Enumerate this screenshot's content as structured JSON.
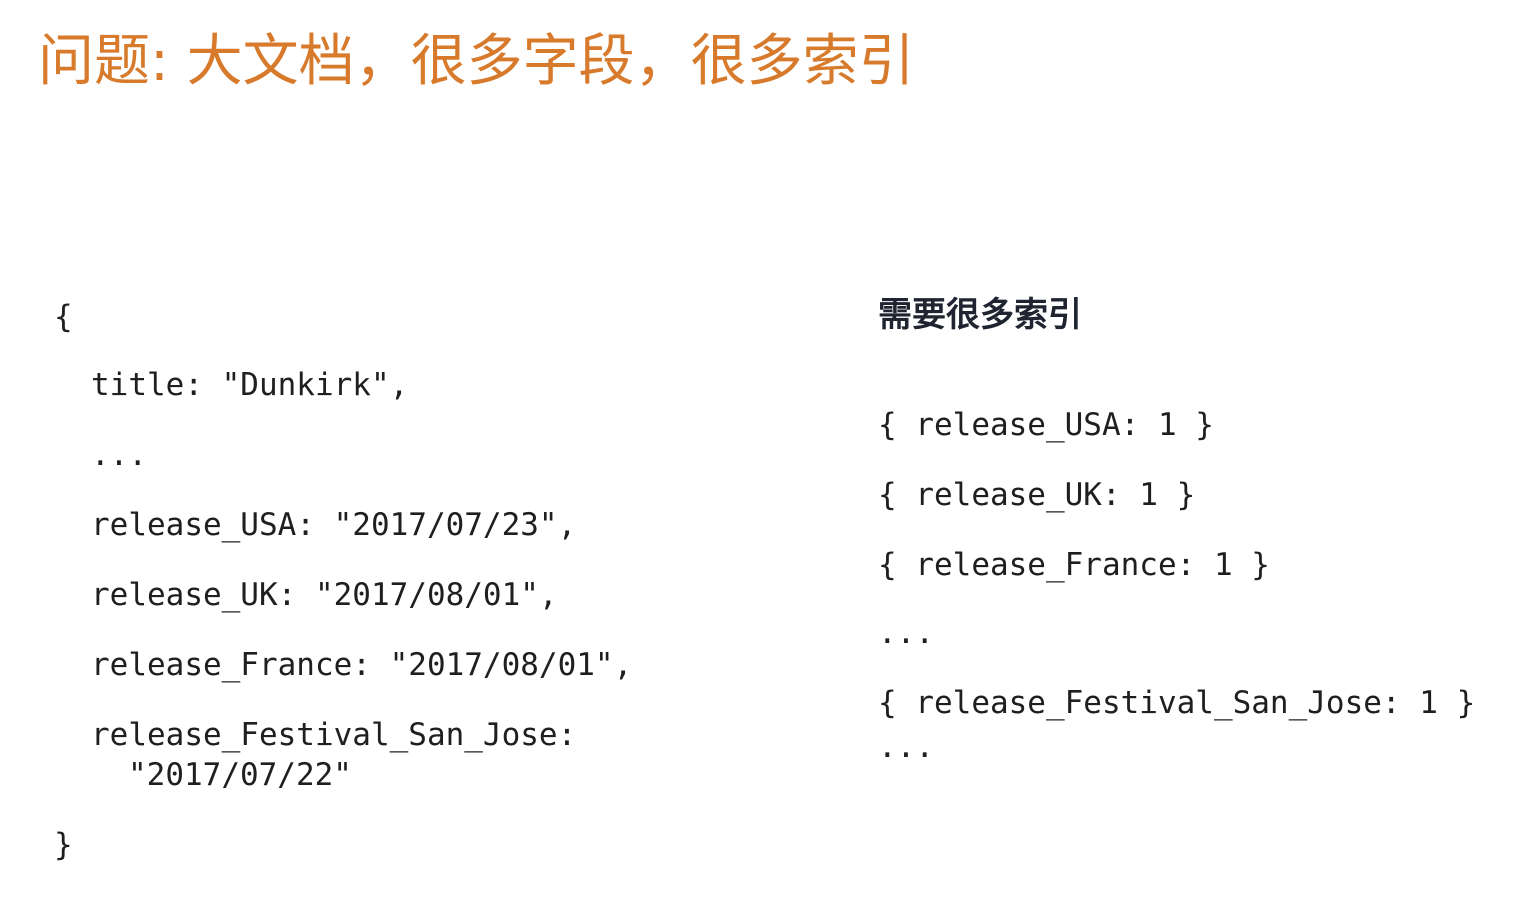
{
  "slide": {
    "title": "问题: 大文档，很多字段，很多索引"
  },
  "document_example": {
    "open_brace": "{",
    "title_line": "title: \"Dunkirk\",",
    "ellipsis": "...",
    "release_usa": "release_USA: \"2017/07/23\",",
    "release_uk": "release_UK: \"2017/08/01\",",
    "release_france": "release_France: \"2017/08/01\",",
    "release_festival_key": "release_Festival_San_Jose:",
    "release_festival_value": "\"2017/07/22\"",
    "close_brace": "}"
  },
  "indexes": {
    "heading": "需要很多索引",
    "items": [
      "{ release_USA: 1 }",
      "{ release_UK: 1 }",
      "{ release_France: 1 }",
      "...",
      "{ release_Festival_San_Jose: 1 }",
      "..."
    ]
  }
}
